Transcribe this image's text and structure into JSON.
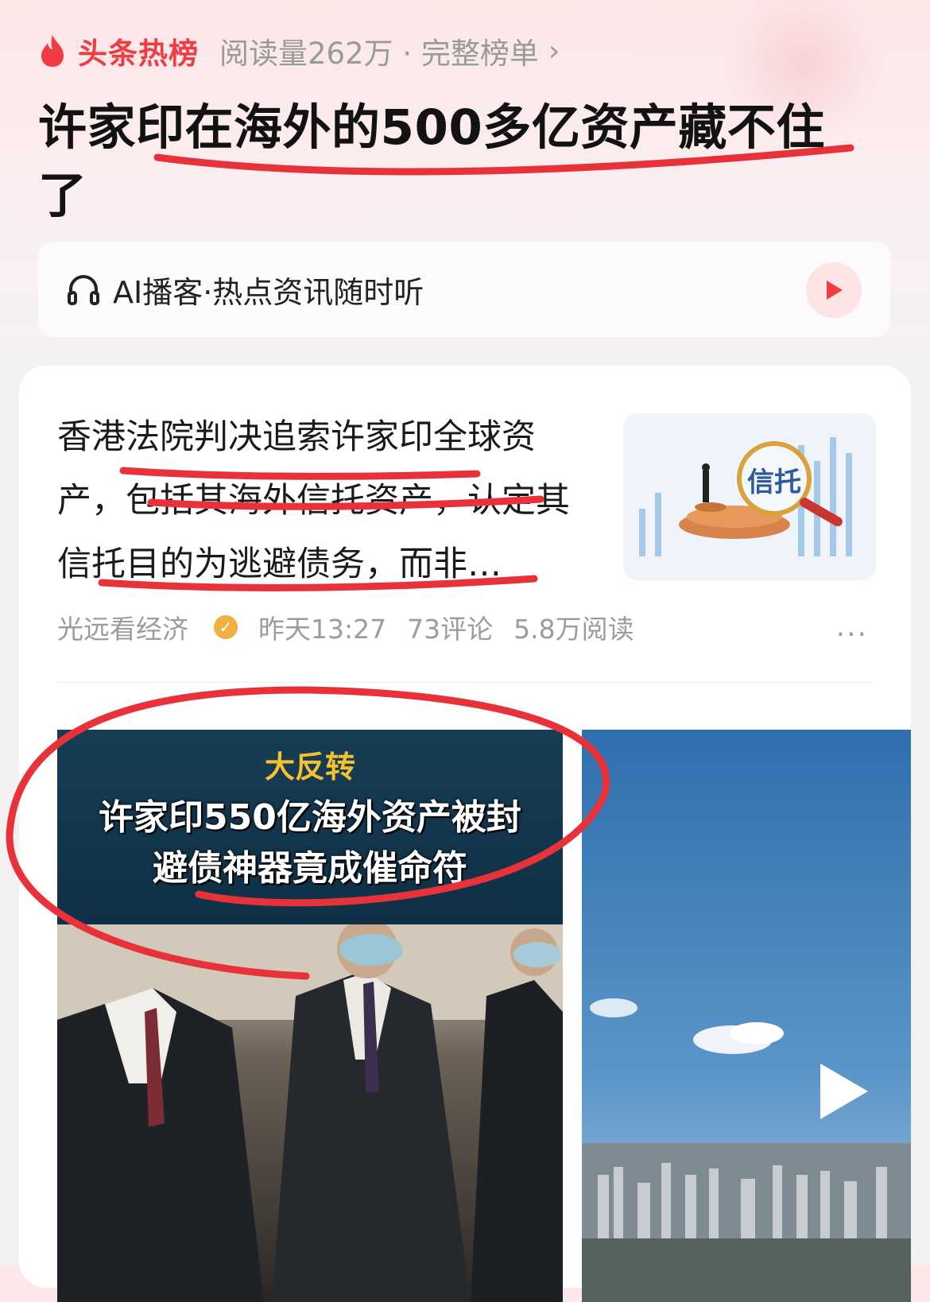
{
  "hot_list": {
    "title": "头条热榜",
    "meta": "阅读量262万 · 完整榜单",
    "chevron": "›"
  },
  "headline": "许家印在海外的500多亿资产藏不住了",
  "ai_podcast": {
    "label": "AI播客·热点资讯随时听"
  },
  "article": {
    "summary": "香港法院判决追索许家印全球资产，包括其海外信托资产，认定其信托目的为逃避债务，而非…",
    "thumbnail_text": "信托",
    "author": "光远看经济",
    "time": "昨天13:27",
    "comments": "73评论",
    "reads": "5.8万阅读",
    "more": "···"
  },
  "video_card": {
    "subtitle": "大反转",
    "line1": "许家印550亿海外资产被封",
    "line2": "避债神器竟成催命符"
  },
  "colors": {
    "accent": "#ef3d43",
    "annotation_ink": "#e8323a"
  }
}
